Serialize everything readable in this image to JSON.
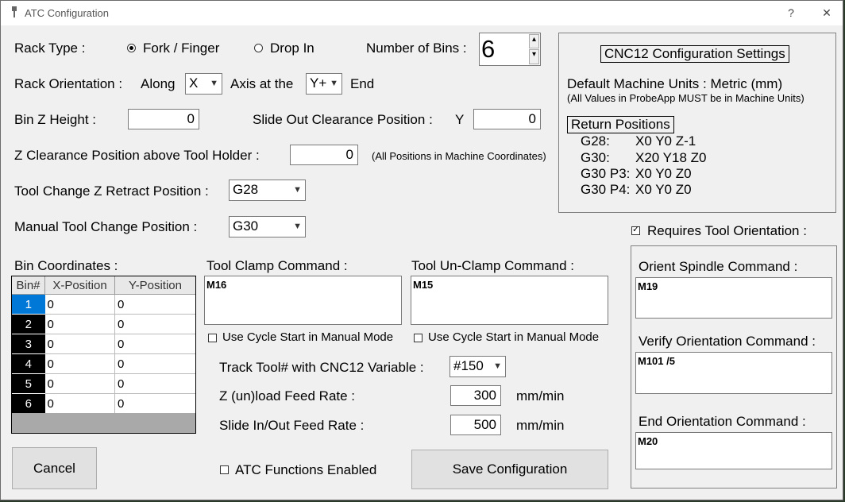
{
  "window": {
    "title": "ATC Configuration",
    "help": "?",
    "close": "✕"
  },
  "rack_type": {
    "label": "Rack Type :",
    "option_fork": "Fork / Finger",
    "option_drop": "Drop In",
    "selected": "Fork / Finger"
  },
  "num_bins": {
    "label": "Number of Bins :",
    "value": "6",
    "up": "▴",
    "down": "▾"
  },
  "rack_orientation": {
    "label": "Rack Orientation :",
    "along": "Along",
    "axis_value": "X",
    "axis_at": "Axis at the",
    "end_value": "Y+",
    "end": "End"
  },
  "bin_z_height": {
    "label": "Bin Z Height :",
    "value": "0"
  },
  "slide_out": {
    "label": "Slide Out Clearance Position :",
    "axis": "Y",
    "value": "0"
  },
  "z_clearance": {
    "label": "Z Clearance Position above Tool Holder :",
    "value": "0",
    "note": "(All Positions in Machine Coordinates)"
  },
  "tool_change_z": {
    "label": "Tool Change Z Retract Position :",
    "value": "G28"
  },
  "manual_tool_change": {
    "label": "Manual Tool Change Position :",
    "value": "G30"
  },
  "cnc12": {
    "title": "CNC12 Configuration Settings",
    "units": "Default Machine Units : Metric (mm)",
    "units_note": "(All Values in ProbeApp MUST be in Machine Units)",
    "return_title": "Return Positions",
    "positions": [
      {
        "name": "G28:",
        "values": "X0  Y0  Z-1"
      },
      {
        "name": "G30:",
        "values": "X20  Y18  Z0"
      },
      {
        "name": "G30 P3:",
        "values": "X0  Y0  Z0"
      },
      {
        "name": "G30 P4:",
        "values": "X0  Y0  Z0"
      }
    ]
  },
  "bin_coordinates": {
    "label": "Bin Coordinates :",
    "headers": [
      "Bin#",
      "X-Position",
      "Y-Position"
    ],
    "rows": [
      {
        "bin": "1",
        "x": "0",
        "y": "0"
      },
      {
        "bin": "2",
        "x": "0",
        "y": "0"
      },
      {
        "bin": "3",
        "x": "0",
        "y": "0"
      },
      {
        "bin": "4",
        "x": "0",
        "y": "0"
      },
      {
        "bin": "5",
        "x": "0",
        "y": "0"
      },
      {
        "bin": "6",
        "x": "0",
        "y": "0"
      }
    ]
  },
  "tool_clamp": {
    "label": "Tool Clamp Command :",
    "value": "M16",
    "cycle_start": "Use Cycle Start in Manual Mode"
  },
  "tool_unclamp": {
    "label": "Tool Un-Clamp Command :",
    "value": "M15",
    "cycle_start": "Use Cycle Start in Manual Mode"
  },
  "track_tool": {
    "label": "Track Tool# with CNC12 Variable :",
    "value": "#150"
  },
  "z_feed": {
    "label": "Z (un)load Feed Rate :",
    "value": "300",
    "unit": "mm/min"
  },
  "slide_feed": {
    "label": "Slide In/Out Feed Rate :",
    "value": "500",
    "unit": "mm/min"
  },
  "orientation": {
    "requires_label": "Requires Tool Orientation :",
    "orient_label": "Orient Spindle Command :",
    "orient_value": "M19",
    "verify_label": "Verify Orientation Command :",
    "verify_value": "M101 /5",
    "end_label": "End Orientation Command :",
    "end_value": "M20"
  },
  "buttons": {
    "cancel": "Cancel",
    "atc_enabled": "ATC Functions Enabled",
    "save": "Save Configuration"
  },
  "colors": {
    "selected_bin": "#0078d7",
    "bin_cell": "#000000"
  }
}
